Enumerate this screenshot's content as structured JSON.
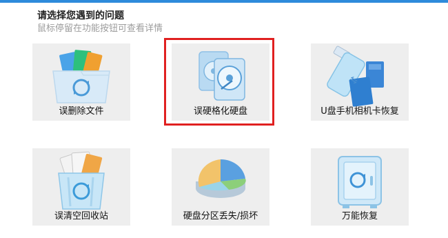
{
  "header": {
    "title": "请选择您遇到的问题",
    "subtitle": "鼠标停留在功能按钮可查看详情"
  },
  "colors": {
    "accent": "#2e8bdb",
    "tile_bg": "#eeeeee",
    "highlight": "#e02020"
  },
  "selected_tile": "tile-format-disk",
  "tiles": [
    {
      "label": "误删除文件",
      "icon": "recycle-folder-icon"
    },
    {
      "label": "误硬格化硬盘",
      "icon": "hard-disk-icon"
    },
    {
      "label": "U盘手机相机卡恢复",
      "icon": "usb-sd-card-icon"
    },
    {
      "label": "误清空回收站",
      "icon": "recycle-bin-icon"
    },
    {
      "label": "硬盘分区丢失/损坏",
      "icon": "pie-partition-icon"
    },
    {
      "label": "万能恢复",
      "icon": "safe-box-icon"
    }
  ]
}
